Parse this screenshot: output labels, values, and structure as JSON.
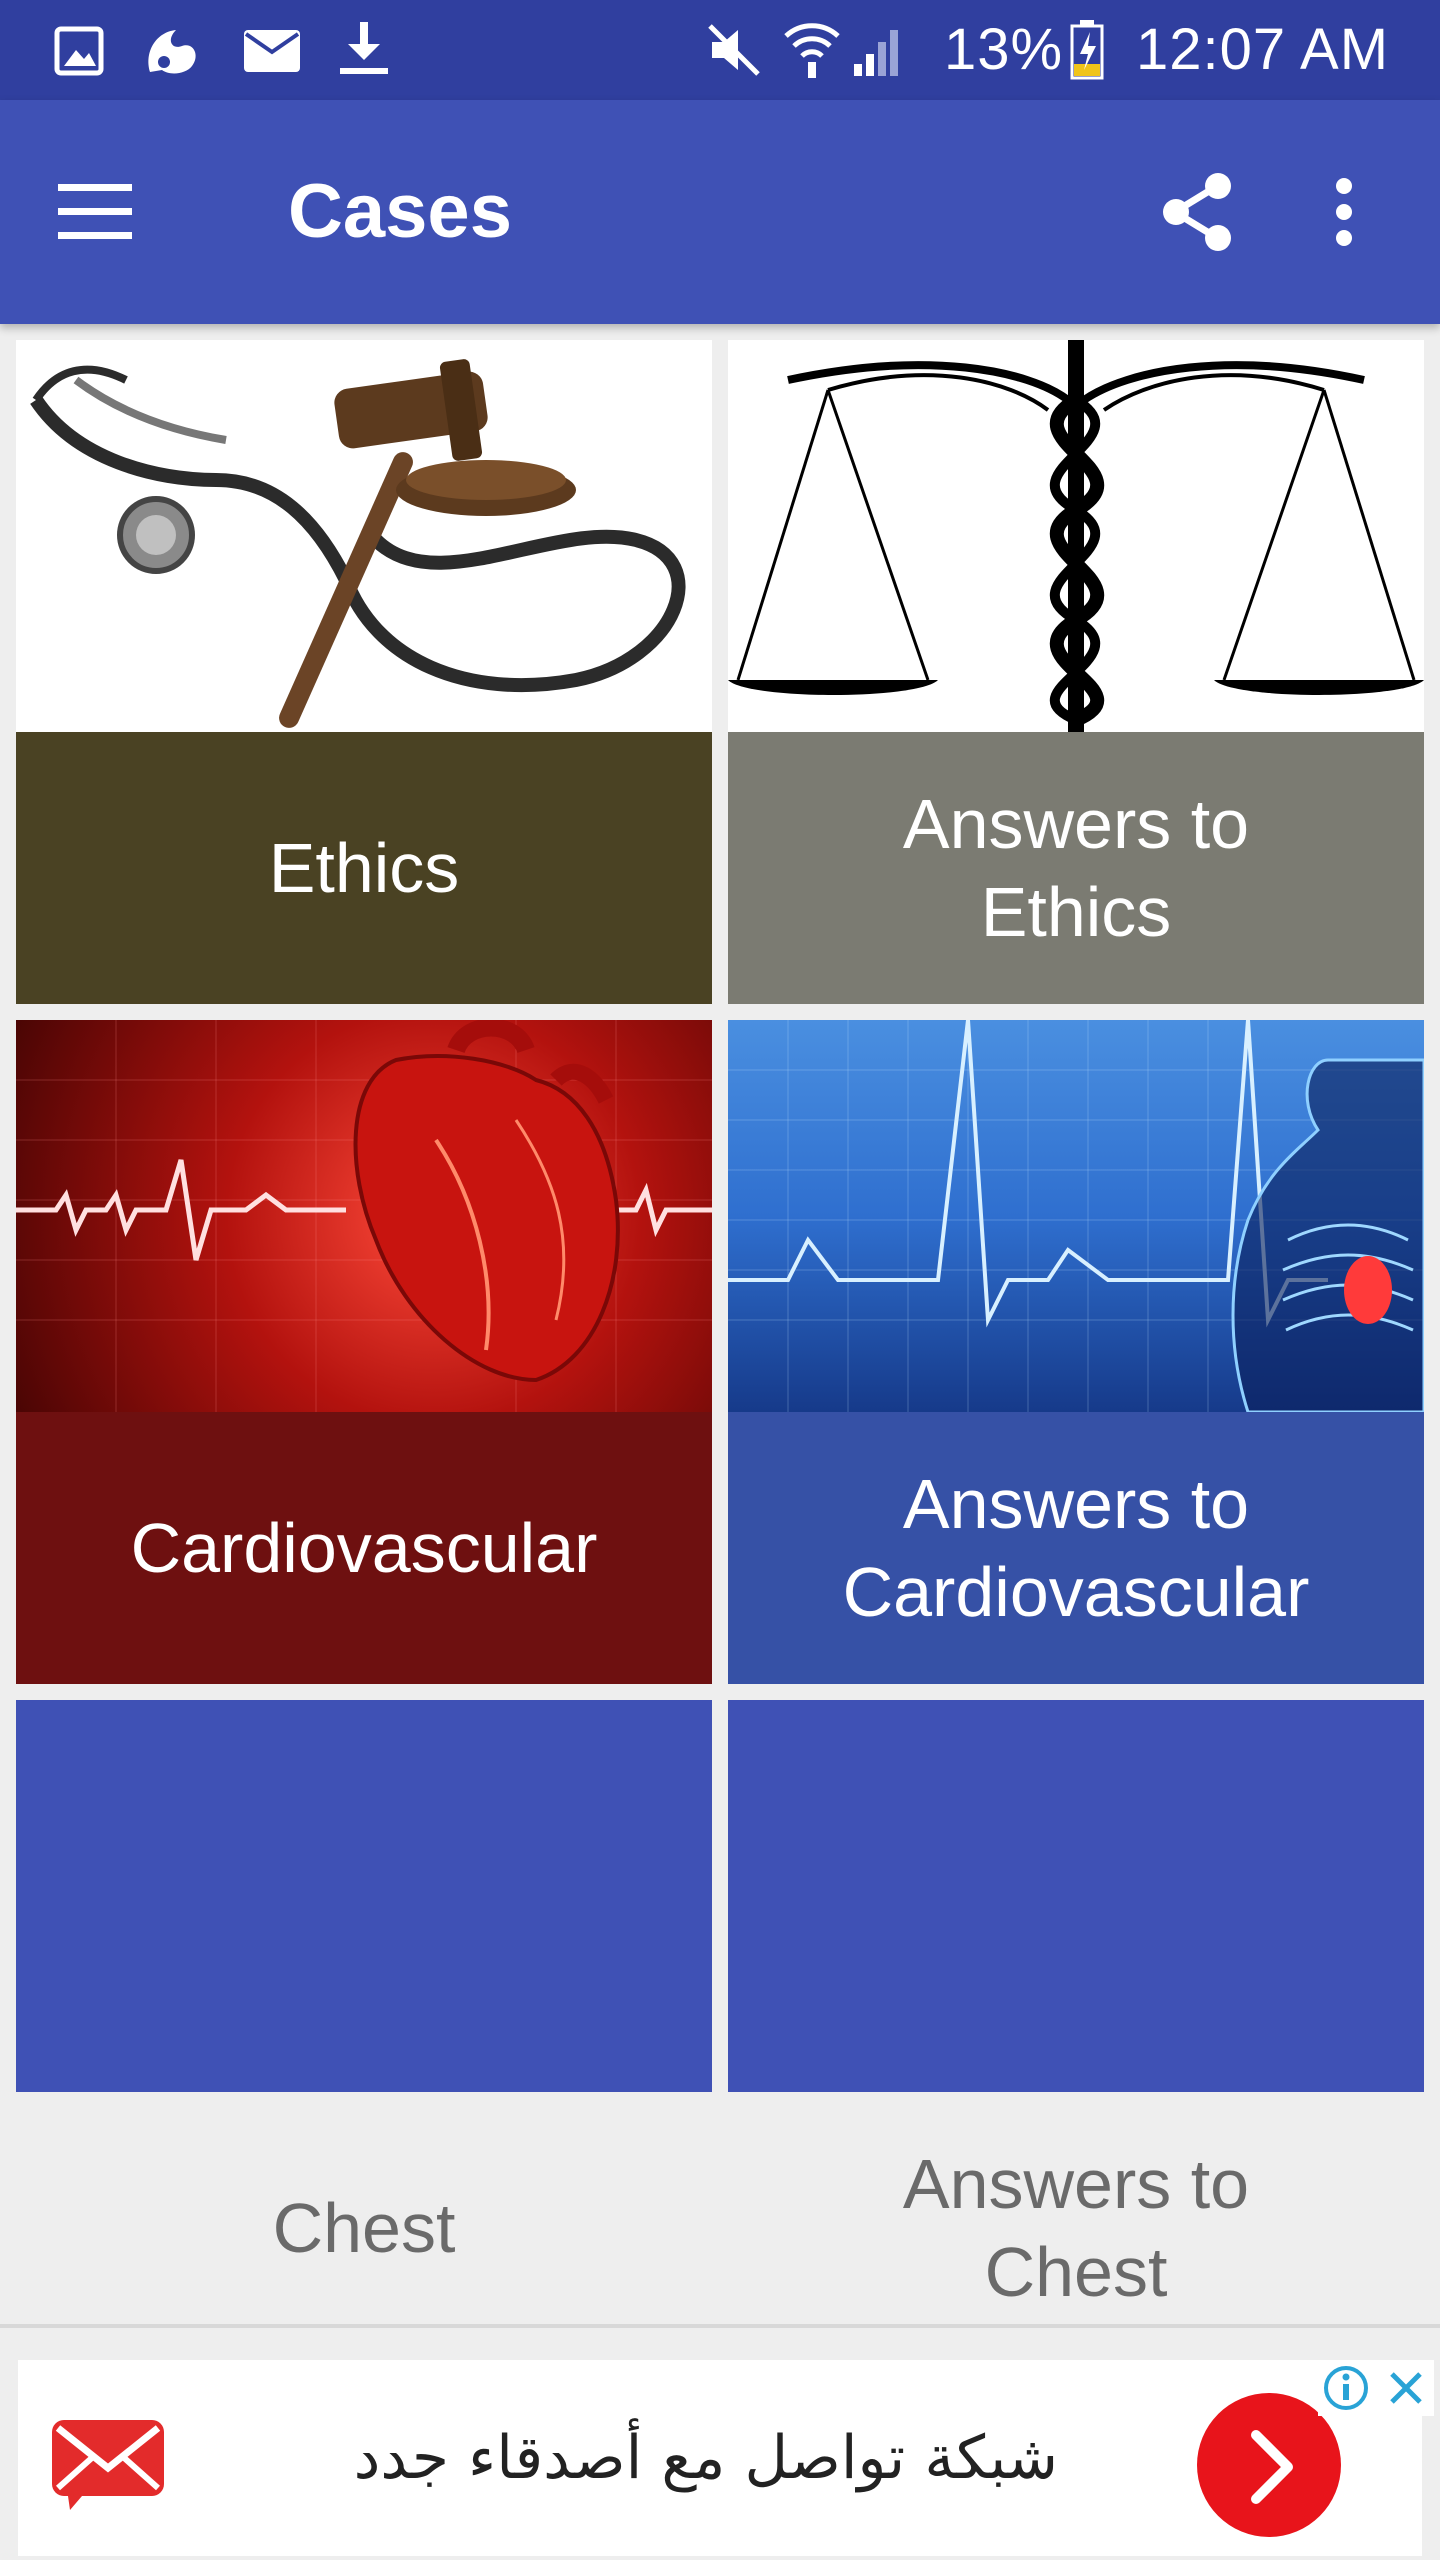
{
  "status_bar": {
    "battery": "13%",
    "time": "12:07 AM",
    "left_icons": [
      "gallery-icon",
      "uc-browser-icon",
      "mail-icon",
      "download-icon"
    ],
    "right_icons": [
      "mute-icon",
      "wifi-icon",
      "signal-icon",
      "battery-charging-icon"
    ]
  },
  "app_bar": {
    "title": "Cases",
    "menu_icon": "hamburger-menu-icon",
    "share_icon": "share-icon",
    "overflow_icon": "more-vert-icon",
    "color": "#3f51b5"
  },
  "tiles": [
    {
      "label_lines": [
        "Ethics"
      ],
      "caption_color": "#4a4223"
    },
    {
      "label_lines": [
        "Answers to",
        "Ethics"
      ],
      "caption_color": "#7b7b72"
    },
    {
      "label_lines": [
        "Cardiovascular"
      ],
      "caption_color": "#6e1010"
    },
    {
      "label_lines": [
        "Answers to",
        "Cardiovascular"
      ],
      "caption_color": "#3651a6"
    },
    {
      "label_lines": [
        "Chest"
      ],
      "caption_color": "#eeeeee"
    },
    {
      "label_lines": [
        "Answers to",
        "Chest"
      ],
      "caption_color": "#eeeeee"
    }
  ],
  "ad": {
    "text": "شبكة تواصل مع أصدقاء جدد",
    "icons": [
      "envelope-icon",
      "ad-info-icon",
      "ad-close-icon",
      "arrow-right-icon"
    ]
  }
}
